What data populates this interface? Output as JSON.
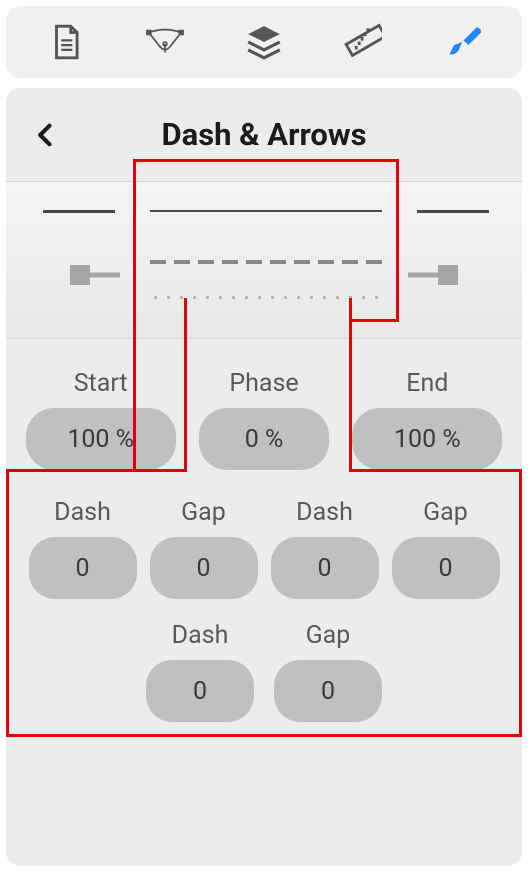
{
  "toolbar": {
    "icons": [
      "document-icon",
      "pen-nib-icon",
      "layers-icon",
      "ruler-icon",
      "brush-icon"
    ],
    "active": "brush"
  },
  "panel": {
    "title": "Dash & Arrows"
  },
  "controls": {
    "start": {
      "label": "Start",
      "value": "100 %"
    },
    "phase": {
      "label": "Phase",
      "value": "0 %"
    },
    "end": {
      "label": "End",
      "value": "100 %"
    }
  },
  "dash_slots": [
    {
      "dash_label": "Dash",
      "gap_label": "Gap",
      "dash": "0",
      "gap": "0"
    },
    {
      "dash_label": "Dash",
      "gap_label": "Gap",
      "dash": "0",
      "gap": "0"
    },
    {
      "dash_label": "Dash",
      "gap_label": "Gap",
      "dash": "0",
      "gap": "0"
    }
  ]
}
